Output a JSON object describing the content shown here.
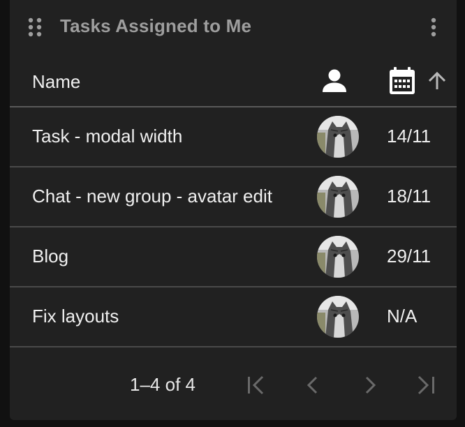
{
  "widget": {
    "title": "Tasks Assigned to Me"
  },
  "columns": {
    "name": "Name",
    "assignee_icon": "person-icon",
    "date_icon": "calendar-icon",
    "sort_icon": "arrow-up-icon",
    "sort_direction": "ascending"
  },
  "tasks": [
    {
      "name": "Task - modal width",
      "date": "14/11",
      "assignee_avatar": "cat-avatar"
    },
    {
      "name": "Chat - new group - avatar edit",
      "date": "18/11",
      "assignee_avatar": "cat-avatar"
    },
    {
      "name": "Blog",
      "date": "29/11",
      "assignee_avatar": "cat-avatar"
    },
    {
      "name": "Fix layouts",
      "date": "N/A",
      "assignee_avatar": "cat-avatar"
    }
  ],
  "pagination": {
    "range": "1–4 of 4",
    "first_icon": "first-page-icon",
    "prev_icon": "chevron-left-icon",
    "next_icon": "chevron-right-icon",
    "last_icon": "last-page-icon"
  },
  "colors": {
    "background": "#111111",
    "card": "#212121",
    "title": "#9e9e9e",
    "text": "#f0f0f0",
    "disabled": "#6a6a6a",
    "divider": "#4a4a4a"
  }
}
